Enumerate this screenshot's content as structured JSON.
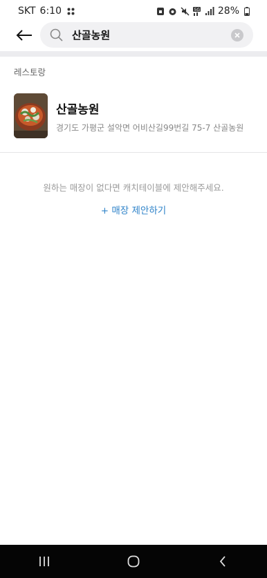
{
  "status_bar": {
    "carrier": "SKT",
    "time": "6:10",
    "battery": "28%"
  },
  "search": {
    "query": "산골농원",
    "placeholder": ""
  },
  "section": {
    "label": "레스토랑"
  },
  "results": [
    {
      "name": "산골농원",
      "address": "경기도 가평군 설악면 어비산길99번길 75-7 산골농원"
    }
  ],
  "empty_message": "원하는 매장이 없다면 캐치테이블에 제안해주세요.",
  "suggest_link": "+ 매장 제안하기",
  "colors": {
    "accent": "#2f83c9",
    "search_bg": "#f1f1f3",
    "nav_bg": "#050505"
  }
}
